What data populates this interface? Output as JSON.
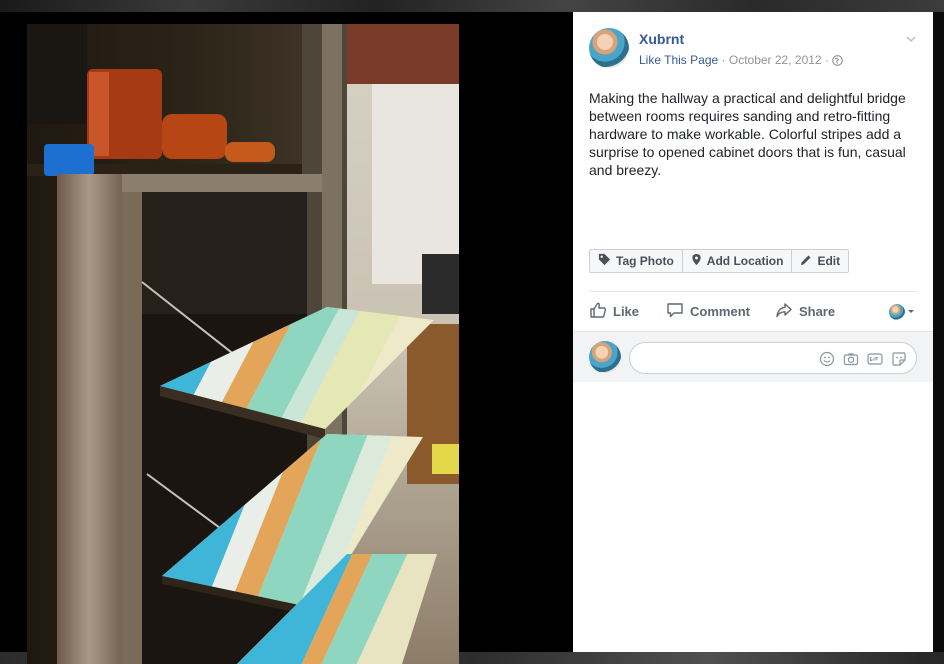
{
  "post": {
    "page_name": "Xubrnt",
    "like_link": "Like This Page",
    "separator": "·",
    "date": "October 22, 2012",
    "caption": "Making the hallway a practical and delightful bridge between rooms requires sanding and retro-fitting hardware to make workable. Colorful stripes add a surprise to opened cabinet doors that is fun, casual and breezy."
  },
  "photo_actions": [
    {
      "label": "Tag Photo",
      "icon": "tag-icon"
    },
    {
      "label": "Add Location",
      "icon": "location-pin-icon"
    },
    {
      "label": "Edit",
      "icon": "pencil-icon"
    }
  ],
  "ufi": {
    "like": "Like",
    "comment": "Comment",
    "share": "Share"
  },
  "comment": {
    "placeholder": "",
    "icons": [
      "emoji-icon",
      "camera-icon",
      "gif-icon",
      "sticker-icon"
    ]
  },
  "colors": {
    "link": "#365899",
    "meta": "#90949c",
    "text": "#1d2129",
    "stripe_blue": "#3fb6d8",
    "stripe_orange": "#e2a55a",
    "stripe_mint": "#8fd6c0",
    "stripe_cream": "#eee9c8"
  }
}
